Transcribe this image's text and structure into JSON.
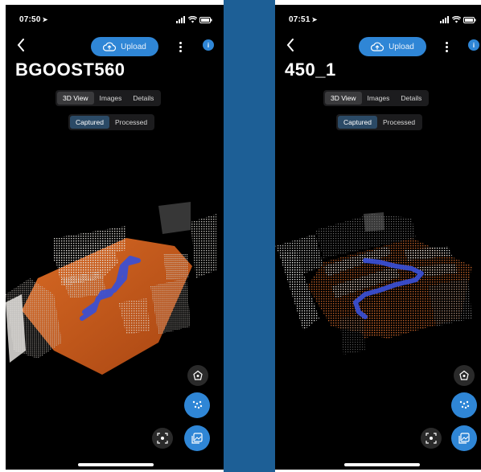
{
  "left": {
    "status_time": "07:50",
    "upload_label": "Upload",
    "info_label": "i",
    "title": "BGOOST560",
    "view_tabs": [
      "3D View",
      "Images",
      "Details"
    ],
    "active_view": "3D View",
    "mode_tabs": [
      "Captured",
      "Processed"
    ],
    "active_mode": "Captured"
  },
  "right": {
    "status_time": "07:51",
    "upload_label": "Upload",
    "info_label": "i",
    "title": "450_1",
    "view_tabs": [
      "3D View",
      "Images",
      "Details"
    ],
    "active_view": "3D View",
    "mode_tabs": [
      "Captured",
      "Processed"
    ],
    "active_mode": "Captured"
  },
  "colors": {
    "accent": "#2f86d6",
    "divider": "#1d5f96",
    "floor": "#c85a1e",
    "trajectory": "#3a4fd6"
  },
  "icons": [
    "location-arrow-icon",
    "signal-icon",
    "wifi-icon",
    "battery-icon",
    "back-chevron-icon",
    "cloud-upload-icon",
    "more-vertical-icon",
    "info-icon",
    "reset-view-icon",
    "point-density-icon",
    "focus-icon",
    "gallery-icon"
  ]
}
